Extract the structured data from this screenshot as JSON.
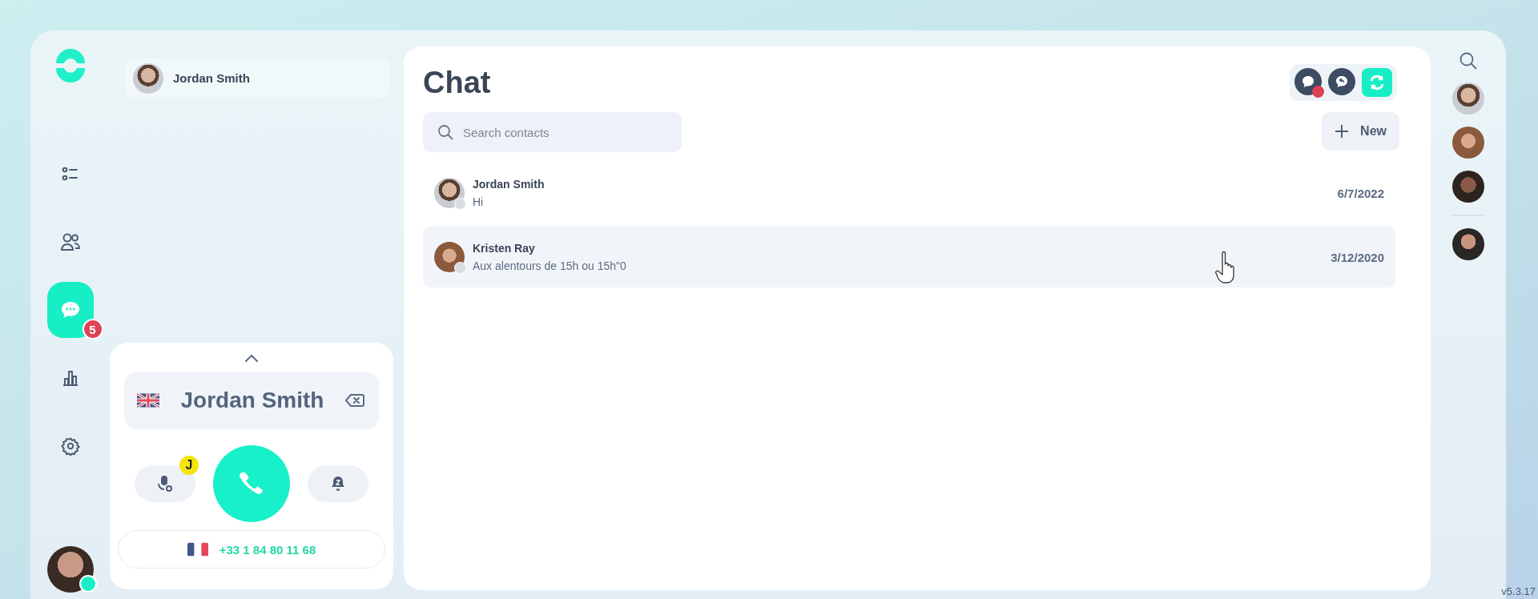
{
  "nav": {
    "items": [
      {
        "selected": false
      },
      {
        "selected": false
      },
      {
        "selected": true,
        "badge": "5"
      },
      {
        "selected": false
      },
      {
        "selected": false
      }
    ],
    "user": {
      "online": true
    }
  },
  "current_user": {
    "name": "Jordan Smith"
  },
  "dialer": {
    "name": "Jordan Smith",
    "voicemail_badge": "J",
    "number": "+33 1 84 80 11 68"
  },
  "chat": {
    "title": "Chat",
    "header_actions": [
      {
        "badge": true,
        "selected": false
      },
      {
        "badge": false,
        "selected": false
      },
      {
        "badge": false,
        "selected": true
      }
    ],
    "search": {
      "placeholder": "Search contacts"
    },
    "new_button": "New",
    "conversations": [
      {
        "name": "Jordan Smith",
        "message": "Hi",
        "date": "6/7/2022",
        "online": false,
        "selected": false
      },
      {
        "name": "Kristen Ray",
        "message": "Aux alentours de 15h ou 15h\"0",
        "date": "3/12/2020",
        "online": false,
        "selected": true
      }
    ]
  },
  "version": "v5.3.17"
}
